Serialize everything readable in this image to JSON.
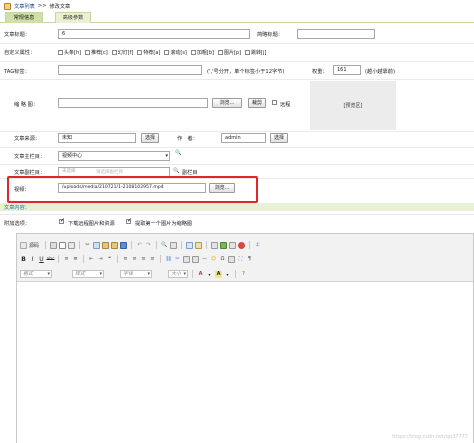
{
  "breadcrumb": {
    "item1": "文章列表",
    "sep": ">>",
    "item2": "修改文章"
  },
  "tabs": [
    {
      "label": "常规信息"
    },
    {
      "label": "高级参数"
    }
  ],
  "form": {
    "title_label": "文章标题：",
    "title_value": "6",
    "short_title_label": "简略标题：",
    "attr_label": "自定义属性：",
    "attrs": [
      "头条[h]",
      "推荐[c]",
      "幻灯[f]",
      "特荐[a]",
      "滚动[s]",
      "加粗[b]",
      "图片[p]",
      "跳转[j]"
    ],
    "tag_label": "TAG标签：",
    "tag_hint": "(','号分开，单个标签小于12字节)",
    "weight_label": "权重：",
    "weight_value": "161",
    "weight_hint": "(越小越靠前)",
    "thumb_label": "缩 略 图：",
    "browse": "浏览...",
    "crop": "裁剪",
    "remote_label": "远程",
    "preview_text": "[预览区]",
    "source_label": "文章来源：",
    "source_value": "未知",
    "select_btn": "选择",
    "author_label": "作　者：",
    "author_value": "admin",
    "column_label": "文章主栏目：",
    "column_value": "视频中心",
    "subcolumn_label": "文章副栏目：",
    "subcolumn_hint": "未选择",
    "subcolumn_hint2": "请选择副栏目",
    "subcolumn_action": "副栏目",
    "video_label": "视频：",
    "video_value": "/uploads/media/210721/1-2108102957.mp4",
    "content_label": "文章内容：",
    "extra_label": "附加选项：",
    "extra1": "下载远程图片和资源",
    "extra2": "提取第一个图片为缩略图"
  },
  "editor": {
    "source_label": "源码",
    "format_placeholder": "格式",
    "style_placeholder": "样式",
    "font_placeholder": "字体",
    "size_placeholder": "大小",
    "bold": "B",
    "italic": "I",
    "underline": "U",
    "strike": "abc"
  },
  "watermark": "https://blog.csdn.net/qq37777"
}
